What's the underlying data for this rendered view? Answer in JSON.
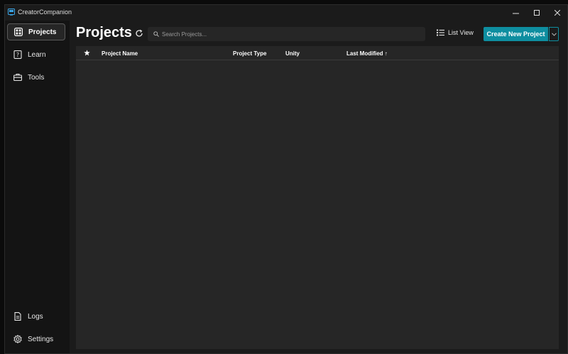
{
  "window": {
    "title": "CreatorCompanion",
    "controls": {
      "minimize": "—",
      "maximize": "☐",
      "close": "✕"
    }
  },
  "sidebar": {
    "items": [
      {
        "label": "Projects",
        "icon": "grid-icon",
        "active": true
      },
      {
        "label": "Learn",
        "icon": "question-book-icon",
        "active": false
      },
      {
        "label": "Tools",
        "icon": "toolbox-icon",
        "active": false
      }
    ],
    "bottom_items": [
      {
        "label": "Logs",
        "icon": "document-icon"
      },
      {
        "label": "Settings",
        "icon": "gear-icon"
      }
    ]
  },
  "header": {
    "title": "Projects",
    "search_placeholder": "Search Projects...",
    "search_value": "",
    "view_label": "List View",
    "create_label": "Create New Project"
  },
  "table": {
    "columns": [
      "Project Name",
      "Project Type",
      "Unity",
      "Last Modified ↑"
    ],
    "rows": []
  },
  "colors": {
    "accent": "#0e8ea0",
    "background": "#1b1b1b",
    "panel": "#262626",
    "sidebar": "#141414"
  }
}
